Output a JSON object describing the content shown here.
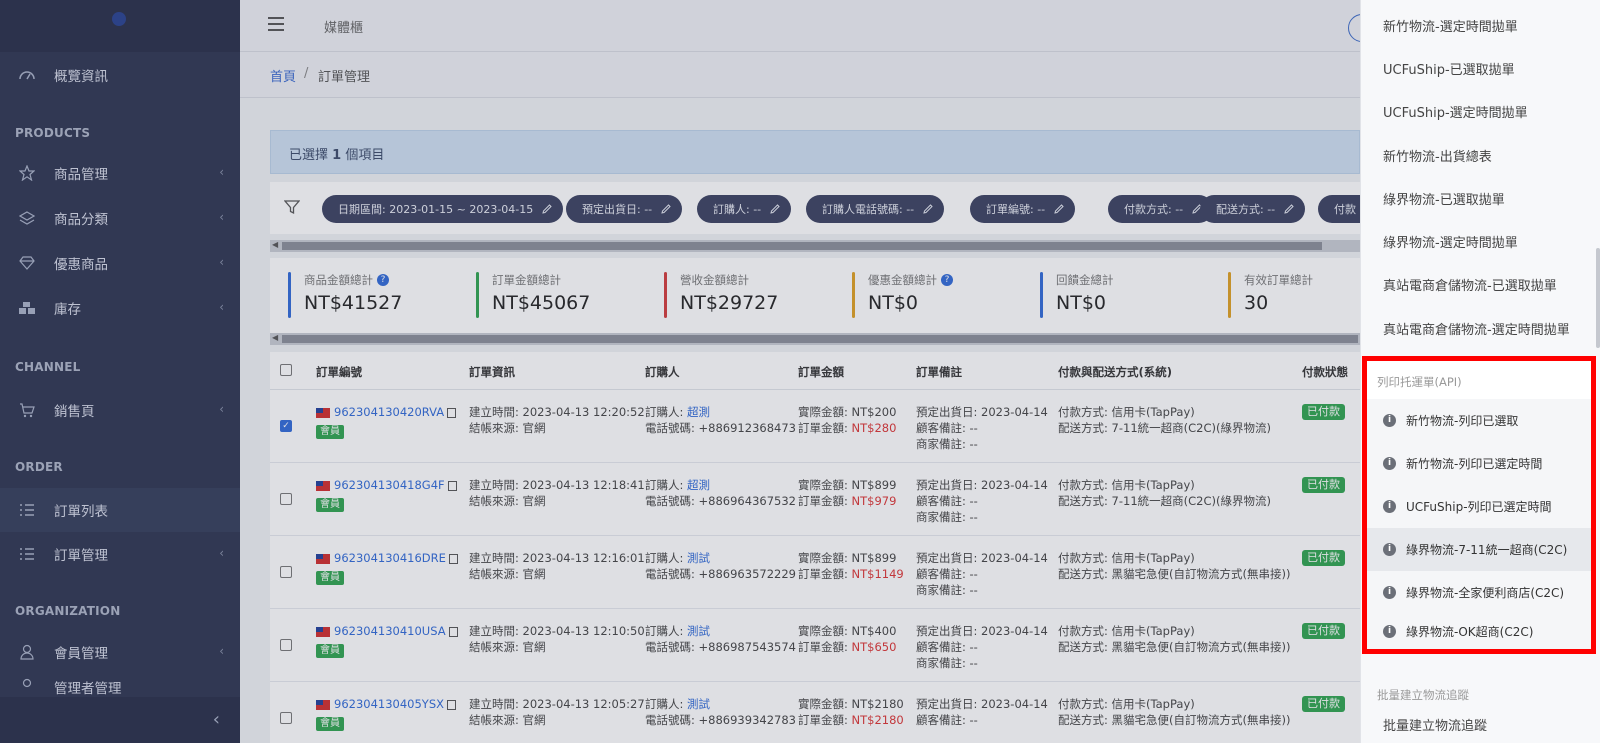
{
  "sidebar": {
    "overview": "概覽資訊",
    "section_products": "PRODUCTS",
    "product_mgmt": "商品管理",
    "product_category": "商品分類",
    "promo_products": "優惠商品",
    "inventory": "庫存",
    "section_channel": "CHANNEL",
    "sales_page": "銷售頁",
    "section_order": "ORDER",
    "order_list": "訂單列表",
    "order_mgmt": "訂單管理",
    "section_organization": "ORGANIZATION",
    "member_mgmt": "會員管理",
    "admin_mgmt": "管理者管理"
  },
  "topbar": {
    "brand": "媒體櫃"
  },
  "breadcrumb": {
    "home": "首頁",
    "sep": "/",
    "current": "訂單管理"
  },
  "selection": {
    "prefix": "已選擇",
    "count": "1",
    "suffix": "個項目"
  },
  "filters": [
    "日期區間: 2023-01-15 ~ 2023-04-15",
    "預定出貨日: --",
    "訂購人: --",
    "訂購人電話號碼: --",
    "訂單編號: --",
    "付款方式: --",
    "配送方式: --",
    "付款"
  ],
  "stats": [
    {
      "label": "商品金額總計",
      "value": "NT$41527",
      "color": "#2f6ad8",
      "help": true
    },
    {
      "label": "訂單金額總計",
      "value": "NT$45067",
      "color": "#2ea44f",
      "help": false
    },
    {
      "label": "營收金額總計",
      "value": "NT$29727",
      "color": "#d33a3a",
      "help": false
    },
    {
      "label": "優惠金額總計",
      "value": "NT$0",
      "color": "#e0a020",
      "help": true
    },
    {
      "label": "回饋金總計",
      "value": "NT$0",
      "color": "#2f6ad8",
      "help": false
    },
    {
      "label": "有效訂單總計",
      "value": "30",
      "color": "#e0a020",
      "help": false
    }
  ],
  "table": {
    "headers": [
      "訂單編號",
      "訂單資訊",
      "訂購人",
      "訂單金額",
      "訂單備註",
      "付款與配送方式(系統)",
      "付款狀態"
    ],
    "member_badge": "會員",
    "rows": [
      {
        "id": "962304130420RVA",
        "checked": true,
        "created": "建立時間: 2023-04-13 12:20:52",
        "source": "結帳來源: 官網",
        "buyer_label": "訂購人: ",
        "buyer": "超測",
        "phone": "電話號碼: +886912368473",
        "actual_label": "實際金額: ",
        "actual": "NT$200",
        "order_label": "訂單金額: ",
        "order": "NT$280",
        "ship_date": "預定出貨日: 2023-04-14",
        "customer_note": "顧客備註: --",
        "merchant_note": "商家備註: --",
        "pay": "付款方式: 信用卡(TapPay)",
        "delivery": "配送方式: 7-11統一超商(C2C)(綠界物流)",
        "status": "已付款"
      },
      {
        "id": "962304130418G4F",
        "checked": false,
        "created": "建立時間: 2023-04-13 12:18:41",
        "source": "結帳來源: 官網",
        "buyer_label": "訂購人: ",
        "buyer": "超測",
        "phone": "電話號碼: +886964367532",
        "actual_label": "實際金額: ",
        "actual": "NT$899",
        "order_label": "訂單金額: ",
        "order": "NT$979",
        "ship_date": "預定出貨日: 2023-04-14",
        "customer_note": "顧客備註: --",
        "merchant_note": "商家備註: --",
        "pay": "付款方式: 信用卡(TapPay)",
        "delivery": "配送方式: 7-11統一超商(C2C)(綠界物流)",
        "status": "已付款"
      },
      {
        "id": "962304130416DRE",
        "checked": false,
        "created": "建立時間: 2023-04-13 12:16:01",
        "source": "結帳來源: 官網",
        "buyer_label": "訂購人: ",
        "buyer": "測試",
        "phone": "電話號碼: +886963572229",
        "actual_label": "實際金額: ",
        "actual": "NT$899",
        "order_label": "訂單金額: ",
        "order": "NT$1149",
        "ship_date": "預定出貨日: 2023-04-14",
        "customer_note": "顧客備註: --",
        "merchant_note": "商家備註: --",
        "pay": "付款方式: 信用卡(TapPay)",
        "delivery": "配送方式: 黑貓宅急便(自訂物流方式(無串接))",
        "status": "已付款"
      },
      {
        "id": "962304130410USA",
        "checked": false,
        "created": "建立時間: 2023-04-13 12:10:50",
        "source": "結帳來源: 官網",
        "buyer_label": "訂購人: ",
        "buyer": "測試",
        "phone": "電話號碼: +886987543574",
        "actual_label": "實際金額: ",
        "actual": "NT$400",
        "order_label": "訂單金額: ",
        "order": "NT$650",
        "ship_date": "預定出貨日: 2023-04-14",
        "customer_note": "顧客備註: --",
        "merchant_note": "商家備註: --",
        "pay": "付款方式: 信用卡(TapPay)",
        "delivery": "配送方式: 黑貓宅急便(自訂物流方式(無串接))",
        "status": "已付款"
      },
      {
        "id": "962304130405YSX",
        "checked": false,
        "created": "建立時間: 2023-04-13 12:05:27",
        "source": "結帳來源: 官網",
        "buyer_label": "訂購人: ",
        "buyer": "測試",
        "phone": "電話號碼: +886939342783",
        "actual_label": "實際金額: ",
        "actual": "NT$2180",
        "order_label": "訂單金額: ",
        "order": "NT$2180",
        "ship_date": "預定出貨日: 2023-04-14",
        "customer_note": "顧客備註: --",
        "merchant_note": "商家備註: --",
        "pay": "付款方式: 信用卡(TapPay)",
        "delivery": "配送方式: 黑貓宅急便(自訂物流方式(無串接))",
        "status": "已付款"
      }
    ]
  },
  "panel": {
    "items_top": [
      "新竹物流-選定時間拋單",
      "UCFuShip-已選取拋單",
      "UCFuShip-選定時間拋單",
      "新竹物流-出貨總表",
      "綠界物流-已選取拋單",
      "綠界物流-選定時間拋單",
      "真站電商倉儲物流-已選取拋單",
      "真站電商倉儲物流-選定時間拋單"
    ],
    "api_section": "列印托運單(API)",
    "api_items": [
      "新竹物流-列印已選取",
      "新竹物流-列印已選定時間",
      "UCFuShip-列印已選定時間",
      "綠界物流-7-11統一超商(C2C)",
      "綠界物流-全家便利商店(C2C)",
      "綠界物流-OK超商(C2C)"
    ],
    "tracking_section": "批量建立物流追蹤",
    "tracking_item": "批量建立物流追蹤"
  }
}
